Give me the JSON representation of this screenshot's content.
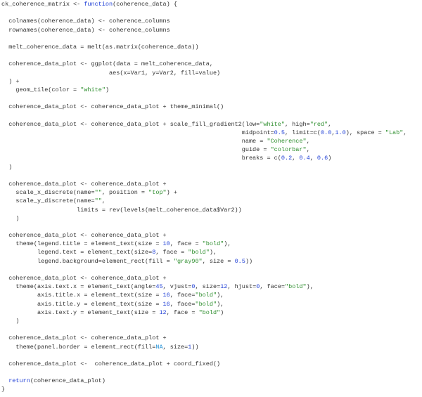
{
  "editor": {
    "language": "R",
    "colors": {
      "text": "#333333",
      "keyword": "#1f3fd6",
      "string": "#2f8f2f",
      "number": "#1f3fd6",
      "constant": "#1f8fd6"
    },
    "lines": [
      [
        {
          "t": "ck_coherence_matrix <- "
        },
        {
          "t": "function",
          "c": "kw"
        },
        {
          "t": "(coherence_data) {"
        }
      ],
      [],
      [
        {
          "t": "  colnames(coherence_data) <- coherence_columns"
        }
      ],
      [
        {
          "t": "  rownames(coherence_data) <- coherence_columns"
        }
      ],
      [],
      [
        {
          "t": "  melt_coherence_data = melt(as.matrix(coherence_data))"
        }
      ],
      [],
      [
        {
          "t": "  coherence_data_plot <- ggplot(data = melt_coherence_data,"
        }
      ],
      [
        {
          "t": "                              aes(x=Var1, y=Var2, fill=value)"
        }
      ],
      [
        {
          "t": "  ) +"
        }
      ],
      [
        {
          "t": "    geom_tile(color = "
        },
        {
          "t": "\"white\"",
          "c": "str"
        },
        {
          "t": ")"
        }
      ],
      [],
      [
        {
          "t": "  coherence_data_plot <- coherence_data_plot + theme_minimal()"
        }
      ],
      [],
      [
        {
          "t": "  coherence_data_plot <- coherence_data_plot + scale_fill_gradient2(low="
        },
        {
          "t": "\"white\"",
          "c": "str"
        },
        {
          "t": ", high="
        },
        {
          "t": "\"red\"",
          "c": "str"
        },
        {
          "t": ","
        }
      ],
      [
        {
          "t": "                                                                   midpoint="
        },
        {
          "t": "0.5",
          "c": "num"
        },
        {
          "t": ", limit=c("
        },
        {
          "t": "0.0",
          "c": "num"
        },
        {
          "t": ","
        },
        {
          "t": "1.0",
          "c": "num"
        },
        {
          "t": "), space = "
        },
        {
          "t": "\"Lab\"",
          "c": "str"
        },
        {
          "t": ","
        }
      ],
      [
        {
          "t": "                                                                   name = "
        },
        {
          "t": "\"Coherence\"",
          "c": "str"
        },
        {
          "t": ","
        }
      ],
      [
        {
          "t": "                                                                   guide = "
        },
        {
          "t": "\"colorbar\"",
          "c": "str"
        },
        {
          "t": ","
        }
      ],
      [
        {
          "t": "                                                                   breaks = c("
        },
        {
          "t": "0.2",
          "c": "num"
        },
        {
          "t": ", "
        },
        {
          "t": "0.4",
          "c": "num"
        },
        {
          "t": ", "
        },
        {
          "t": "0.6",
          "c": "num"
        },
        {
          "t": ")"
        }
      ],
      [
        {
          "t": "  )"
        }
      ],
      [],
      [
        {
          "t": "  coherence_data_plot <- coherence_data_plot +"
        }
      ],
      [
        {
          "t": "    scale_x_discrete(name="
        },
        {
          "t": "\"\"",
          "c": "str"
        },
        {
          "t": ", position = "
        },
        {
          "t": "\"top\"",
          "c": "str"
        },
        {
          "t": ") +"
        }
      ],
      [
        {
          "t": "    scale_y_discrete(name="
        },
        {
          "t": "\"\"",
          "c": "str"
        },
        {
          "t": ","
        }
      ],
      [
        {
          "t": "                     limits = rev(levels(melt_coherence_data$Var2))"
        }
      ],
      [
        {
          "t": "    )"
        }
      ],
      [],
      [
        {
          "t": "  coherence_data_plot <- coherence_data_plot +"
        }
      ],
      [
        {
          "t": "    theme(legend.title = element_text(size = "
        },
        {
          "t": "10",
          "c": "num"
        },
        {
          "t": ", face = "
        },
        {
          "t": "\"bold\"",
          "c": "str"
        },
        {
          "t": "),"
        }
      ],
      [
        {
          "t": "          legend.text = element_text(size="
        },
        {
          "t": "8",
          "c": "num"
        },
        {
          "t": ", face = "
        },
        {
          "t": "\"bold\"",
          "c": "str"
        },
        {
          "t": "),"
        }
      ],
      [
        {
          "t": "          legend.background=element_rect(fill = "
        },
        {
          "t": "\"gray90\"",
          "c": "str"
        },
        {
          "t": ", size = "
        },
        {
          "t": "0.5",
          "c": "num"
        },
        {
          "t": "))"
        }
      ],
      [],
      [
        {
          "t": "  coherence_data_plot <- coherence_data_plot +"
        }
      ],
      [
        {
          "t": "    theme(axis.text.x = element_text(angle="
        },
        {
          "t": "45",
          "c": "num"
        },
        {
          "t": ", vjust="
        },
        {
          "t": "0",
          "c": "num"
        },
        {
          "t": ", size="
        },
        {
          "t": "12",
          "c": "num"
        },
        {
          "t": ", hjust="
        },
        {
          "t": "0",
          "c": "num"
        },
        {
          "t": ", face="
        },
        {
          "t": "\"bold\"",
          "c": "str"
        },
        {
          "t": "),"
        }
      ],
      [
        {
          "t": "          axis.title.x = element_text(size = "
        },
        {
          "t": "16",
          "c": "num"
        },
        {
          "t": ", face="
        },
        {
          "t": "\"bold\"",
          "c": "str"
        },
        {
          "t": "),"
        }
      ],
      [
        {
          "t": "          axis.title.y = element_text(size = "
        },
        {
          "t": "16",
          "c": "num"
        },
        {
          "t": ", face="
        },
        {
          "t": "\"bold\"",
          "c": "str"
        },
        {
          "t": "),"
        }
      ],
      [
        {
          "t": "          axis.text.y = element_text(size = "
        },
        {
          "t": "12",
          "c": "num"
        },
        {
          "t": ", face = "
        },
        {
          "t": "\"bold\"",
          "c": "str"
        },
        {
          "t": ")"
        }
      ],
      [
        {
          "t": "    )"
        }
      ],
      [],
      [
        {
          "t": "  coherence_data_plot <- coherence_data_plot +"
        }
      ],
      [
        {
          "t": "    theme(panel.border = element_rect(fill="
        },
        {
          "t": "NA",
          "c": "const"
        },
        {
          "t": ", size="
        },
        {
          "t": "1",
          "c": "num"
        },
        {
          "t": "))"
        }
      ],
      [],
      [
        {
          "t": "  coherence_data_plot <-  coherence_data_plot + coord_fixed()"
        }
      ],
      [],
      [
        {
          "t": "  "
        },
        {
          "t": "return",
          "c": "kw"
        },
        {
          "t": "(coherence_data_plot)"
        }
      ],
      [
        {
          "t": "}"
        }
      ]
    ]
  }
}
